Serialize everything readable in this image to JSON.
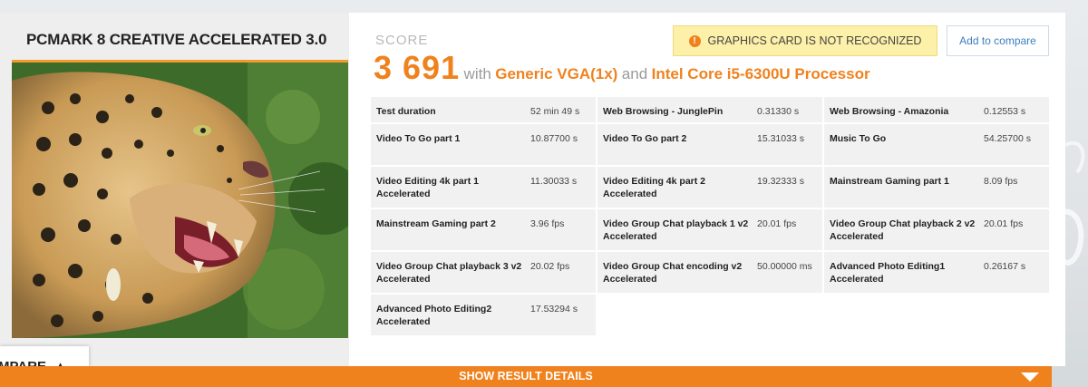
{
  "benchmark": {
    "title": "PCMARK 8 CREATIVE ACCELERATED 3.0",
    "image_icon": "leopard-image"
  },
  "score": {
    "label": "SCORE",
    "value": "3 691",
    "with_text": "with",
    "gpu": "Generic VGA(1x)",
    "and_text": "and",
    "cpu": "Intel Core i5-6300U Processor"
  },
  "warning": {
    "icon": "exclamation-icon",
    "text": "GRAPHICS CARD IS NOT RECOGNIZED"
  },
  "actions": {
    "add_to_compare": "Add to compare",
    "compare_tab": "MPARE",
    "show_details": "SHOW RESULT DETAILS"
  },
  "results": [
    [
      {
        "name": "Test duration",
        "value": "52 min 49 s"
      },
      {
        "name": "Web Browsing - JunglePin",
        "value": "0.31330 s"
      },
      {
        "name": "Web Browsing - Amazonia",
        "value": "0.12553 s"
      }
    ],
    [
      {
        "name": "Video To Go part 1",
        "value": "10.87700 s"
      },
      {
        "name": "Video To Go part 2",
        "value": "15.31033 s"
      },
      {
        "name": "Music To Go",
        "value": "54.25700 s"
      }
    ],
    [
      {
        "name": "Video Editing 4k part 1 Accelerated",
        "value": "11.30033 s"
      },
      {
        "name": "Video Editing 4k part 2 Accelerated",
        "value": "19.32333 s"
      },
      {
        "name": "Mainstream Gaming part 1",
        "value": "8.09 fps"
      }
    ],
    [
      {
        "name": "Mainstream Gaming part 2",
        "value": "3.96 fps"
      },
      {
        "name": "Video Group Chat playback 1 v2 Accelerated",
        "value": "20.01 fps"
      },
      {
        "name": "Video Group Chat playback 2 v2 Accelerated",
        "value": "20.01 fps"
      }
    ],
    [
      {
        "name": "Video Group Chat playback 3 v2 Accelerated",
        "value": "20.02 fps"
      },
      {
        "name": "Video Group Chat encoding v2 Accelerated",
        "value": "50.00000 ms"
      },
      {
        "name": "Advanced Photo Editing1 Accelerated",
        "value": "0.26167 s"
      }
    ],
    [
      {
        "name": "Advanced Photo Editing2 Accelerated",
        "value": "17.53294 s"
      }
    ]
  ],
  "colors": {
    "accent": "#f0821e",
    "link": "#3b7fc0",
    "warning_bg": "#fdf0a9"
  }
}
